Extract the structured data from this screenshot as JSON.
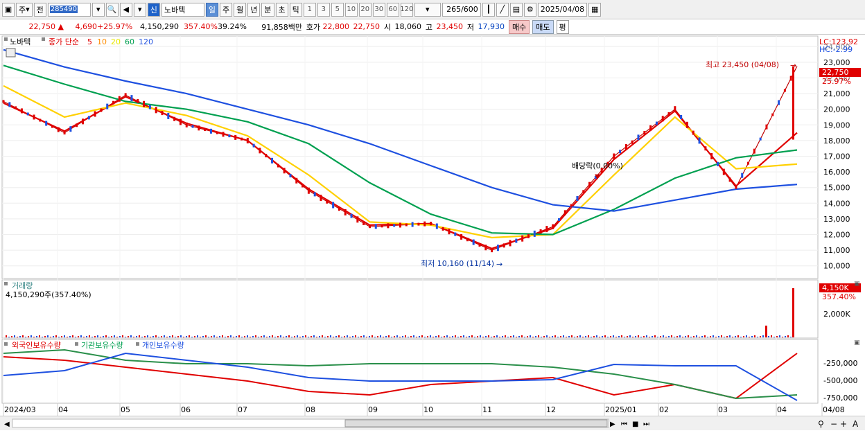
{
  "toolbar": {
    "period_main": "주",
    "prev": "전",
    "code": "285490",
    "new_badge": "신",
    "stock_name": "노바텍",
    "periods": [
      "일",
      "주",
      "월",
      "년",
      "분",
      "초",
      "틱"
    ],
    "intervals": [
      "1",
      "3",
      "5",
      "10",
      "20",
      "30",
      "60",
      "120"
    ],
    "count": "265",
    "count_total": "/600",
    "date": "2025/04/08"
  },
  "quote": {
    "price": "22,750",
    "arrow": "▲",
    "change": "4,690",
    "change_pct": "+25.97%",
    "volume": "4,150,290",
    "volume_ratio": "357.40%",
    "turnover": "39.24%",
    "amount": "91,858백만",
    "bid_label": "호가",
    "bid": "22,800",
    "ask": "22,750",
    "open_label": "시",
    "open": "18,060",
    "high_label": "고",
    "high": "23,450",
    "low_label": "저",
    "low": "17,930",
    "buy": "매수",
    "sell": "매도",
    "avg": "평"
  },
  "legend": {
    "name": "노바텍",
    "ma_label": "종가 단순",
    "ma_periods": [
      "5",
      "10",
      "20",
      "60",
      "120"
    ],
    "ma_colors": [
      "#e00000",
      "#ff8c00",
      "#e8e800",
      "#00a050",
      "#1e50e0"
    ],
    "lc": "LC:123.92",
    "hc": "HC:-2.99"
  },
  "annotations": {
    "high": "최고 23,450 (04/08)",
    "low": "최저 10,160 (11/14)",
    "dividend": "배당락(0.00%)",
    "last_price": "22,750",
    "last_pct": "25.97%"
  },
  "volume_panel": {
    "title": "거래량",
    "value": "4,150,290주(357.40%)",
    "last": "4,150K",
    "last_pct": "357.40%",
    "ticks": [
      "2,000K"
    ]
  },
  "holding_panel": {
    "titles": [
      "외국인보유수량",
      "기관보유수량",
      "개인보유수량"
    ],
    "colors": [
      "#e00000",
      "#00a050",
      "#1e50e0"
    ],
    "ticks": [
      "-250,000",
      "-500,000",
      "-750,000"
    ]
  },
  "price_ticks": [
    "24,000",
    "23,000",
    "22,000",
    "21,000",
    "20,000",
    "19,000",
    "18,000",
    "17,000",
    "16,000",
    "15,000",
    "14,000",
    "13,000",
    "12,000",
    "11,000",
    "10,000"
  ],
  "x_labels": [
    "2024/03",
    "04",
    "05",
    "06",
    "07",
    "08",
    "09",
    "10",
    "11",
    "12",
    "2025/01",
    "02",
    "03",
    "04",
    "04/08"
  ],
  "chart_data": {
    "type": "line",
    "title": "노바텍",
    "ylim": [
      9500,
      24500
    ],
    "x": [
      "2024/03",
      "04",
      "05",
      "06",
      "07",
      "08",
      "09",
      "10",
      "11",
      "12",
      "2025/01",
      "02",
      "03",
      "04"
    ],
    "series": [
      {
        "name": "종가",
        "values": [
          20500,
          18500,
          20900,
          19000,
          18000,
          14800,
          12500,
          12700,
          11000,
          12500,
          17000,
          20000,
          15000,
          22750
        ]
      },
      {
        "name": "5",
        "values": [
          20400,
          18600,
          20800,
          19100,
          18000,
          14900,
          12600,
          12700,
          11100,
          12400,
          16800,
          19900,
          15100,
          18500
        ]
      },
      {
        "name": "20",
        "values": [
          21500,
          19500,
          20400,
          19600,
          18300,
          15800,
          12800,
          12600,
          11800,
          12000,
          15800,
          19500,
          16200,
          16500
        ]
      },
      {
        "name": "60",
        "values": [
          22800,
          21600,
          20500,
          20000,
          19200,
          17800,
          15300,
          13300,
          12100,
          12000,
          13600,
          15600,
          16900,
          17400
        ]
      },
      {
        "name": "120",
        "values": [
          23800,
          22700,
          21800,
          21000,
          20000,
          19000,
          17800,
          16400,
          15000,
          13900,
          13500,
          14200,
          14900,
          15200
        ]
      }
    ]
  }
}
